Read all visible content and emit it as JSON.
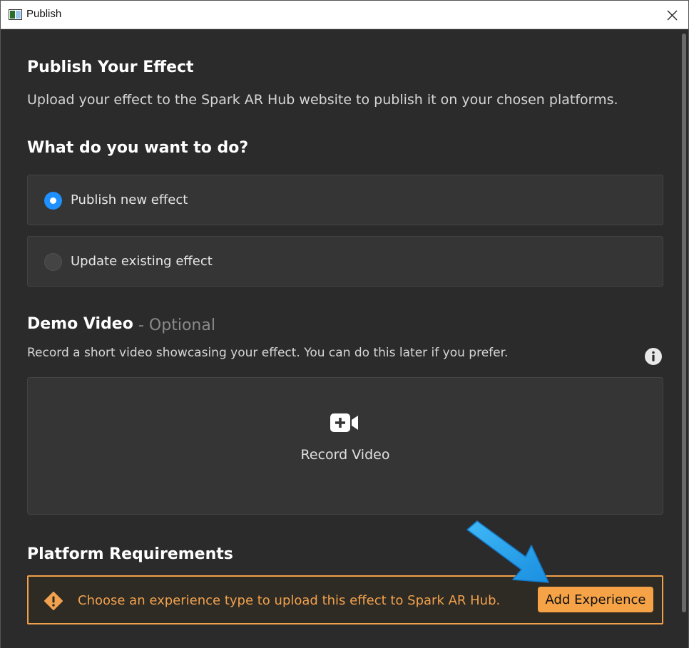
{
  "window": {
    "title": "Publish"
  },
  "publish": {
    "heading": "Publish Your Effect",
    "description": "Upload your effect to the Spark AR Hub website to publish it on your chosen platforms."
  },
  "action": {
    "heading": "What do you want to do?",
    "options": [
      {
        "label": "Publish new effect",
        "selected": true
      },
      {
        "label": "Update existing effect",
        "selected": false
      }
    ]
  },
  "demo_video": {
    "heading": "Demo Video",
    "optional_label": "- Optional",
    "description": "Record a short video showcasing your effect. You can do this later if you prefer.",
    "record_label": "Record Video",
    "icon": "video-add-icon"
  },
  "platform": {
    "heading": "Platform Requirements",
    "warning_text": "Choose an experience type to upload this effect to Spark AR Hub.",
    "button_label": "Add Experience"
  },
  "colors": {
    "accent_blue": "#1e90ff",
    "warning_orange": "#f0a04a",
    "button_orange": "#f6a347",
    "background": "#2b2b2b"
  }
}
